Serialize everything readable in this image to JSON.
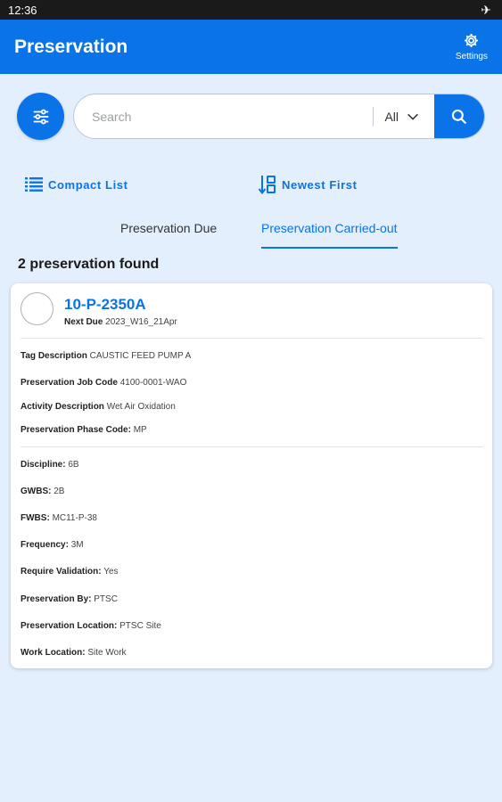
{
  "status_bar": {
    "time": "12:36",
    "airplane_icon": "airplane-icon"
  },
  "app_bar": {
    "title": "Preservation",
    "settings_label": "Settings",
    "settings_icon": "gear-icon"
  },
  "search": {
    "placeholder": "Search",
    "value": "",
    "scope": "All",
    "filter_icon": "sliders-icon",
    "search_icon": "search-icon"
  },
  "toolbar": {
    "view_label": "Compact List",
    "view_icon": "list-icon",
    "sort_label": "Newest First",
    "sort_icon": "sort-icon"
  },
  "tabs": [
    {
      "label": "Preservation Due",
      "active": false
    },
    {
      "label": "Preservation Carried-out",
      "active": true
    }
  ],
  "result_count": "2 preservation found",
  "card": {
    "tag": "10-P-2350A",
    "next_due_label": "Next Due",
    "next_due_value": "2023_W16_21Apr",
    "group1": [
      {
        "label": "Tag Description",
        "value": "CAUSTIC FEED PUMP A"
      },
      {
        "label": "Preservation Job Code",
        "value": "4100-0001-WAO"
      },
      {
        "label": "Activity Description",
        "value": "Wet Air Oxidation"
      },
      {
        "label": "Preservation Phase Code:",
        "value": "MP"
      }
    ],
    "group2": [
      {
        "label": "Discipline:",
        "value": "6B"
      },
      {
        "label": "GWBS:",
        "value": "2B"
      },
      {
        "label": "FWBS:",
        "value": "MC11-P-38"
      },
      {
        "label": "Frequency:",
        "value": "3M"
      },
      {
        "label": "Require Validation:",
        "value": "Yes"
      },
      {
        "label": "Preservation By:",
        "value": "PTSC"
      },
      {
        "label": "Preservation Location:",
        "value": "PTSC Site"
      },
      {
        "label": "Work Location:",
        "value": "Site Work"
      }
    ]
  },
  "colors": {
    "primary": "#0a73e8",
    "background": "#e3effc"
  }
}
